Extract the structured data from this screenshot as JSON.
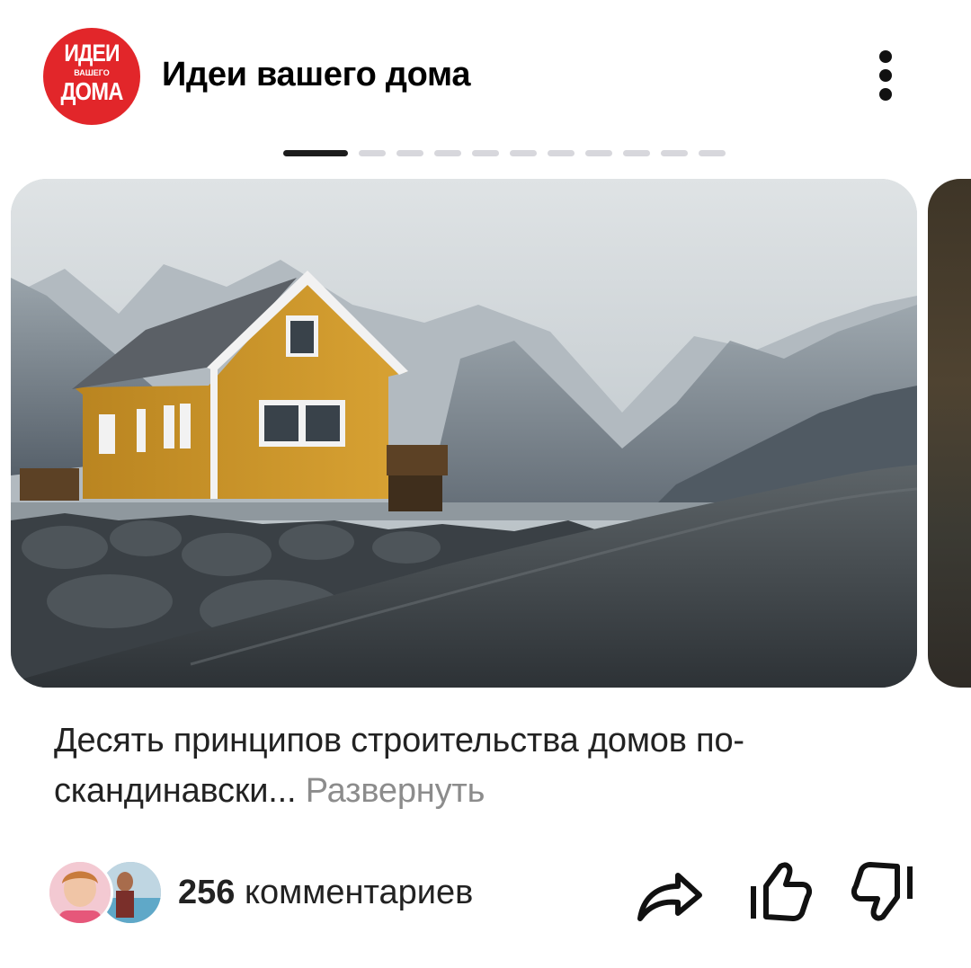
{
  "channel": {
    "logo_line1": "ИДЕИ",
    "logo_line2": "ВАШЕГО",
    "logo_line3": "ДОМА",
    "title": "Идеи вашего дома"
  },
  "pager": {
    "total": 11,
    "active_index": 0
  },
  "post": {
    "description": "Десять принципов строительства домов по-скандинавски...",
    "expand_label": "Развернуть"
  },
  "footer": {
    "comments_count": "256",
    "comments_label": "комментариев"
  },
  "colors": {
    "brand_red": "#e2262a",
    "house_yellow": "#d09a2a",
    "muted_text": "#8c8c8c",
    "pager_active": "#1c1c1c",
    "pager_inactive": "#d7d7dc"
  },
  "icons": {
    "menu": "more-vertical-icon",
    "share": "share-arrow-icon",
    "like": "thumbs-up-icon",
    "dislike": "thumbs-down-icon"
  }
}
